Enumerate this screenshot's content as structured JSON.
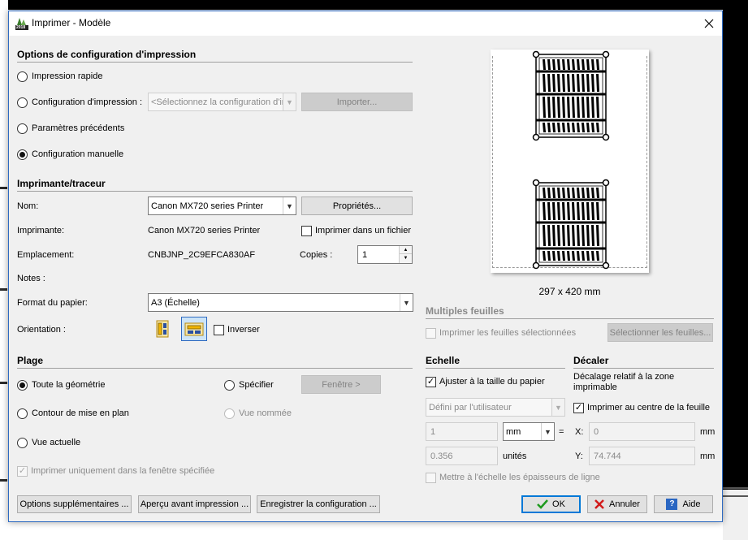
{
  "window": {
    "title": "Imprimer - Modèle",
    "icon_year": "2018"
  },
  "config": {
    "heading": "Options de configuration d'impression",
    "radio_quick": "Impression rapide",
    "radio_config": "Configuration d'impression :",
    "config_placeholder": "<Sélectionnez la configuration d'in",
    "import_button": "Importer...",
    "radio_previous": "Paramètres précédents",
    "radio_manual": "Configuration manuelle"
  },
  "printer": {
    "heading": "Imprimante/traceur",
    "name_label": "Nom:",
    "name_value": "Canon MX720 series Printer",
    "properties_button": "Propriétés...",
    "printer_label": "Imprimante:",
    "printer_value": "Canon MX720 series Printer",
    "print_to_file": "Imprimer dans un fichier",
    "location_label": "Emplacement:",
    "location_value": "CNBJNP_2C9EFCA830AF",
    "copies_label": "Copies :",
    "copies_value": "1",
    "notes_label": "Notes :",
    "paper_label": "Format du papier:",
    "paper_value": "A3 (Échelle)",
    "orientation_label": "Orientation :",
    "invert_label": "Inverser"
  },
  "range": {
    "heading": "Plage",
    "all_geometry": "Toute la géométrie",
    "specify": "Spécifier",
    "window_button": "Fenêtre >",
    "layout_outline": "Contour de mise en plan",
    "named_view": "Vue nommée",
    "current_view": "Vue actuelle",
    "only_window": "Imprimer uniquement dans la fenêtre spécifiée"
  },
  "preview": {
    "size_label": "297 x 420 mm"
  },
  "multi": {
    "heading": "Multiples feuilles",
    "print_selected": "Imprimer les feuilles sélectionnées",
    "select_button": "Sélectionner les feuilles..."
  },
  "scale": {
    "heading": "Echelle",
    "fit_paper": "Ajuster à la taille du papier",
    "scale_combo": "Défini par l'utilisateur",
    "value1": "1",
    "unit_combo": "mm",
    "equals": "=",
    "value2": "0.356",
    "units_label": "unités",
    "line_weights": "Mettre à l'échelle les épaisseurs de ligne"
  },
  "offset": {
    "heading": "Décaler",
    "description": "Décalage relatif à la zone imprimable",
    "center": "Imprimer au centre de la feuille",
    "x_label": "X:",
    "x_value": "0",
    "y_label": "Y:",
    "y_value": "74.744",
    "unit": "mm"
  },
  "footer": {
    "more_options": "Options supplémentaires ...",
    "preview": "Aperçu avant impression ...",
    "save_config": "Enregistrer la configuration ...",
    "ok": "OK",
    "cancel": "Annuler",
    "help": "Aide"
  }
}
